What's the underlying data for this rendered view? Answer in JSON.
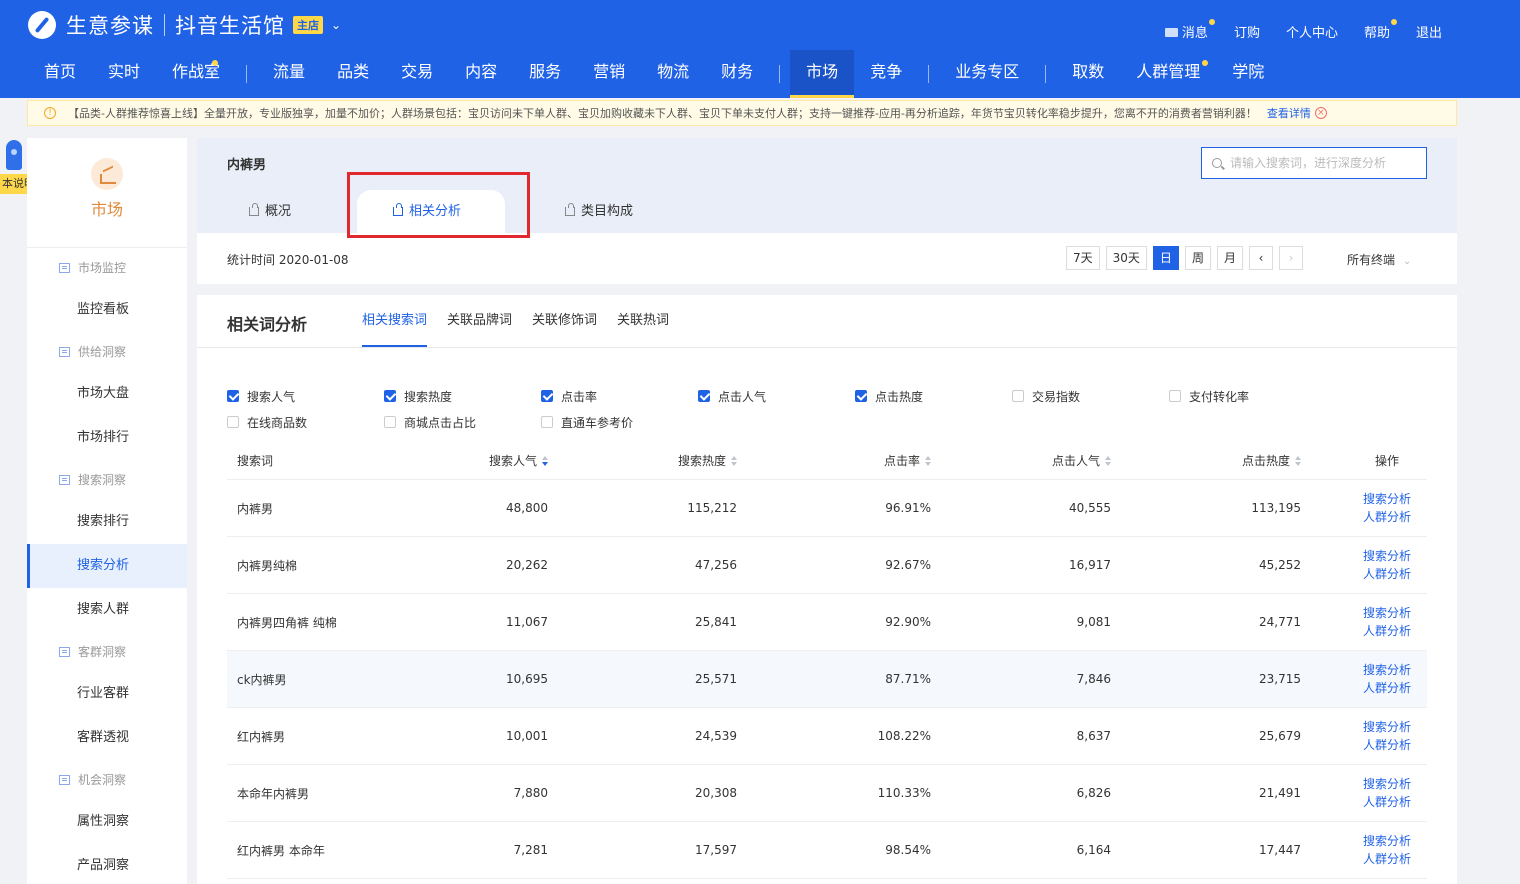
{
  "header": {
    "app_name": "生意参谋",
    "shop_name": "抖音生活馆",
    "shop_badge": "主店",
    "top_links": [
      "消息",
      "订购",
      "个人中心",
      "帮助",
      "退出"
    ],
    "nav": [
      "首页",
      "实时",
      "作战室",
      "流量",
      "品类",
      "交易",
      "内容",
      "服务",
      "营销",
      "物流",
      "财务",
      "市场",
      "竞争",
      "业务专区",
      "取数",
      "人群管理",
      "学院"
    ],
    "nav_active": "市场"
  },
  "notice": {
    "text": "【品类-人群推荐惊喜上线】全量开放，专业版独享，加量不加价；人群场景包括：宝贝访问未下单人群、宝贝加购收藏未下人群、宝贝下单未支付人群；支持一键推荐-应用-再分析追踪，年货节宝贝转化率稳步提升，您离不开的消费者营销利器！",
    "link": "查看详情"
  },
  "float_help": {
    "label": "本说明"
  },
  "sidebar": {
    "title": "市场",
    "groups": [
      {
        "name": "市场监控",
        "items": [
          "监控看板"
        ]
      },
      {
        "name": "供给洞察",
        "items": [
          "市场大盘",
          "市场排行"
        ]
      },
      {
        "name": "搜索洞察",
        "items": [
          "搜索排行",
          "搜索分析",
          "搜索人群"
        ]
      },
      {
        "name": "客群洞察",
        "items": [
          "行业客群",
          "客群透视"
        ]
      },
      {
        "name": "机会洞察",
        "items": [
          "属性洞察",
          "产品洞察"
        ]
      }
    ],
    "active_item": "搜索分析"
  },
  "keyword_card": {
    "keyword": "内裤男",
    "search_placeholder": "请输入搜索词，进行深度分析",
    "tabs": [
      "概况",
      "相关分析",
      "类目构成"
    ],
    "active_tab": "相关分析",
    "stat_time": "统计时间 2020-01-08",
    "range_buttons": [
      "7天",
      "30天",
      "日",
      "周",
      "月"
    ],
    "range_active": "日",
    "terminal": "所有终端"
  },
  "analysis": {
    "title": "相关词分析",
    "subtabs": [
      "相关搜索词",
      "关联品牌词",
      "关联修饰词",
      "关联热词"
    ],
    "active_subtab": "相关搜索词",
    "checkboxes": [
      {
        "label": "搜索人气",
        "checked": true
      },
      {
        "label": "搜索热度",
        "checked": true
      },
      {
        "label": "点击率",
        "checked": true
      },
      {
        "label": "点击人气",
        "checked": true
      },
      {
        "label": "点击热度",
        "checked": true
      },
      {
        "label": "交易指数",
        "checked": false
      },
      {
        "label": "支付转化率",
        "checked": false
      },
      {
        "label": "在线商品数",
        "checked": false
      },
      {
        "label": "商城点击占比",
        "checked": false
      },
      {
        "label": "直通车参考价",
        "checked": false
      }
    ],
    "columns": [
      "搜索词",
      "搜索人气",
      "搜索热度",
      "点击率",
      "点击人气",
      "点击热度",
      "操作"
    ],
    "rows": [
      [
        "内裤男",
        "48,800",
        "115,212",
        "96.91%",
        "40,555",
        "113,195"
      ],
      [
        "内裤男纯棉",
        "20,262",
        "47,256",
        "92.67%",
        "16,917",
        "45,252"
      ],
      [
        "内裤男四角裤 纯棉",
        "11,067",
        "25,841",
        "92.90%",
        "9,081",
        "24,771"
      ],
      [
        "ck内裤男",
        "10,695",
        "25,571",
        "87.71%",
        "7,846",
        "23,715"
      ],
      [
        "红内裤男",
        "10,001",
        "24,539",
        "108.22%",
        "8,637",
        "25,679"
      ],
      [
        "本命年内裤男",
        "7,880",
        "20,308",
        "110.33%",
        "6,826",
        "21,491"
      ],
      [
        "红内裤男 本命年",
        "7,281",
        "17,597",
        "98.54%",
        "6,164",
        "17,447"
      ]
    ],
    "row_actions": [
      "搜索分析",
      "人群分析"
    ]
  }
}
